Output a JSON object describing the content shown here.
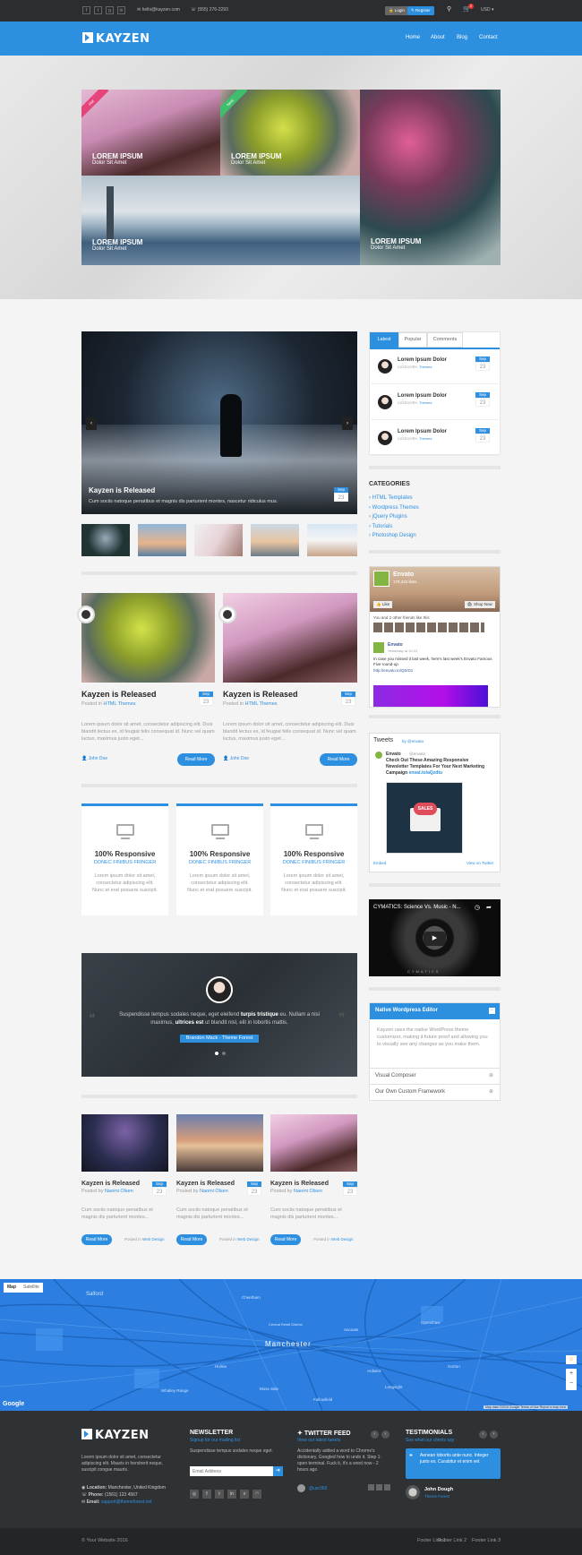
{
  "colors": {
    "accent": "#2d8fe0",
    "dark": "#2b2d30",
    "footer": "#2b2d30"
  },
  "topbar": {
    "social": [
      "f",
      "t",
      "g",
      "in"
    ],
    "email": "hello@kayzen.com",
    "phone": "(555) 276-2293",
    "login": "Login",
    "register": "Register",
    "currency": "USD",
    "cart_count": "2"
  },
  "nav": {
    "logo": "KAYZEN",
    "links": [
      "Home",
      "About",
      "Blog",
      "Contact"
    ]
  },
  "hero": {
    "tiles": [
      {
        "title": "LOREM IPSUM",
        "sub": "Dolor Sit Amet",
        "ribbon": "Hot"
      },
      {
        "title": "LOREM IPSUM",
        "sub": "Dolor Sit Amet",
        "ribbon": "New"
      },
      {
        "title": "LOREM IPSUM",
        "sub": "Dolor Sit Amet"
      },
      {
        "title": "LOREM IPSUM",
        "sub": "Dolor Sit Amet"
      }
    ]
  },
  "slider": {
    "title": "Kayzen is Released",
    "text": "Cum sociis natoque penatibus et magnis dis parturient montes, nascetur ridiculus mus.",
    "month": "Sep",
    "day": "23"
  },
  "posts": [
    {
      "title": "Kayzen is Released",
      "posted_in": "Posted in",
      "category": "HTML Themes",
      "month": "Sep",
      "day": "23",
      "excerpt": "Lorem ipsum dolor sit amet, consectetur adipiscing elit. Duis blandit lectus ex, id feugiat felis consequat id. Nunc vel quam luctus, maximus justo eget...",
      "author": "John Doe",
      "more": "Read More"
    },
    {
      "title": "Kayzen is Released",
      "posted_in": "Posted in",
      "category": "HTML Themes",
      "month": "Sep",
      "day": "23",
      "excerpt": "Lorem ipsum dolor sit amet, consectetur adipiscing elit. Duis blandit lectus ex, id feugiat felis consequat id. Nunc vel quam luctus, maximus justo eget...",
      "author": "John Doe",
      "more": "Read More"
    }
  ],
  "features": [
    {
      "title": "100% Responsive",
      "sub": "DONEC FINIBUS FRINGER",
      "text": "Lorem ipsum dolor sit amet, consectetur adipiscing elit. Nunc et erat posuere suscipit."
    },
    {
      "title": "100% Responsive",
      "sub": "DONEC FINIBUS FRINGER",
      "text": "Lorem ipsum dolor sit amet, consectetur adipiscing elit. Nunc et erat posuere suscipit."
    },
    {
      "title": "100% Responsive",
      "sub": "DONEC FINIBUS FRINGER",
      "text": "Lorem ipsum dolor sit amet, consectetur adipiscing elit. Nunc et erat posuere suscipit."
    }
  ],
  "testimonial": {
    "pre": "Suspendisse tempus sodales neque, eget eleifend",
    "bold1": "turpis tristique",
    "mid": "eu. Nullam a nisi maximus,",
    "bold2": "ultrices est",
    "post": "ut blandit nisl, elit in lobortis mattis.",
    "author": "Brandon Mack - Theme Forest"
  },
  "small_posts": [
    {
      "title": "Kayzen is Released",
      "by": "Posted by",
      "author": "Naomi Olsen",
      "month": "Sep",
      "day": "23",
      "excerpt": "Cum sociis natoque penatibus et magnis dis parturient montes...",
      "more": "Read More",
      "posted_in": "Posted in",
      "category": "Web Design"
    },
    {
      "title": "Kayzen is Released",
      "by": "Posted by",
      "author": "Naomi Olsen",
      "month": "Sep",
      "day": "23",
      "excerpt": "Cum sociis natoque penatibus et magnis dis parturient montes...",
      "more": "Read More",
      "posted_in": "Posted in",
      "category": "Web Design"
    },
    {
      "title": "Kayzen is Released",
      "by": "Posted by",
      "author": "Naomi Olsen",
      "month": "Sep",
      "day": "23",
      "excerpt": "Cum sociis natoque penatibus et magnis dis parturient montes...",
      "more": "Read More",
      "posted_in": "Posted in",
      "category": "Web Design"
    }
  ],
  "sidebar": {
    "tabs": [
      "Latest",
      "Popular",
      "Comments"
    ],
    "latest": [
      {
        "title": "Lorem Ipsum Dolor",
        "cat_label": "CATEGORY:",
        "cat": "Themes",
        "month": "Sep",
        "day": "23"
      },
      {
        "title": "Lorem Ipsum Dolor",
        "cat_label": "CATEGORY:",
        "cat": "Themes",
        "month": "Sep",
        "day": "23"
      },
      {
        "title": "Lorem Ipsum Dolor",
        "cat_label": "CATEGORY:",
        "cat": "Themes",
        "month": "Sep",
        "day": "23"
      }
    ],
    "categories_title": "CATEGORIES",
    "categories": [
      "HTML Templates",
      "Wordpress Themes",
      "jQuery Plugins",
      "Tutorials",
      "Photoshop Design"
    ],
    "fb": {
      "name": "Envato",
      "likes": "179,234 likes",
      "like": "Like",
      "shop": "Shop Now",
      "friends": "You and 2 other friends like this",
      "post_name": "Envato",
      "post_time": "Yesterday at 10:31",
      "post_text": "In case you missed it last week, here's last week's Envato Famous Five round-up",
      "post_link": "http://envato.to/Q5rD1"
    },
    "tweets": {
      "title": "Tweets",
      "by": "by @envato",
      "name": "Envato",
      "handle": "@envato",
      "text": "Check Out These Amazing Responsive Newsletter Templates For Your Next Marketing Campaign",
      "link": "envat.to/aQzdtu",
      "badge": "SALES",
      "embed": "Embed",
      "view": "View on Twitter"
    },
    "video": {
      "title": "CYMATICS: Science Vs. Music - N...",
      "brand": "CYMATICS"
    },
    "accordion": {
      "open_title": "Native Wordpress Editor",
      "open_text": "Kayzen uses the native WordPress theme customizer, making it future proof and allowing you to visually see any changes as you make them.",
      "items": [
        "Visual Composer",
        "Our Own Custom Framework"
      ]
    }
  },
  "map": {
    "tabs": [
      "Map",
      "Satellite"
    ],
    "city": "Manchester",
    "places": [
      "Salford",
      "Central Retail District",
      "Ancoats",
      "Openshaw",
      "Gorton",
      "Ardwick",
      "Hulme",
      "Moss Side",
      "Fallowfield",
      "Longsight",
      "Whalley Range",
      "Cheetham"
    ],
    "google": "Google",
    "copy": "Map data ©2016 Google",
    "terms": "Terms of Use",
    "report": "Report a map error"
  },
  "footer": {
    "logo": "KAYZEN",
    "about": "Lorem ipsum dolor sit amet, consectetur adipiscing elit. Mauris in hendrerit neque, suscipit congue mauris.",
    "loc_label": "Location:",
    "location": "Manchester, United Kingdom",
    "phone_label": "Phone:",
    "phone": "(1561) 123 4567",
    "email_label": "Email:",
    "email": "support@themeforest.net",
    "newsletter_title": "NEWSLETTER",
    "newsletter_sub": "Signup for our mailing list",
    "newsletter_text": "Suspendisse tempus sodales neque eget.",
    "email_placeholder": "Email Address",
    "twitter_title": "TWITTER FEED",
    "twitter_sub": "View our latest tweets",
    "twitter_text": "Accidentally added a word to Chrome's dictionary. Googled how to undo it. Step 1: open terminal. Fuck it, it's a word now - 2 hours ago",
    "twitter_user": "@usr360",
    "testimonials_title": "TESTIMONIALS",
    "testimonials_sub": "See what our clients say",
    "quote": "Aenean lobortis ante nunc. Integer justo ex. Curabitur et enim vel.",
    "q_author": "John Dough",
    "q_role": "Theme Forest",
    "copyright": "© Your Website 2016",
    "links": [
      "Footer Link 1",
      "Footer Link 2",
      "Footer Link 3"
    ]
  }
}
